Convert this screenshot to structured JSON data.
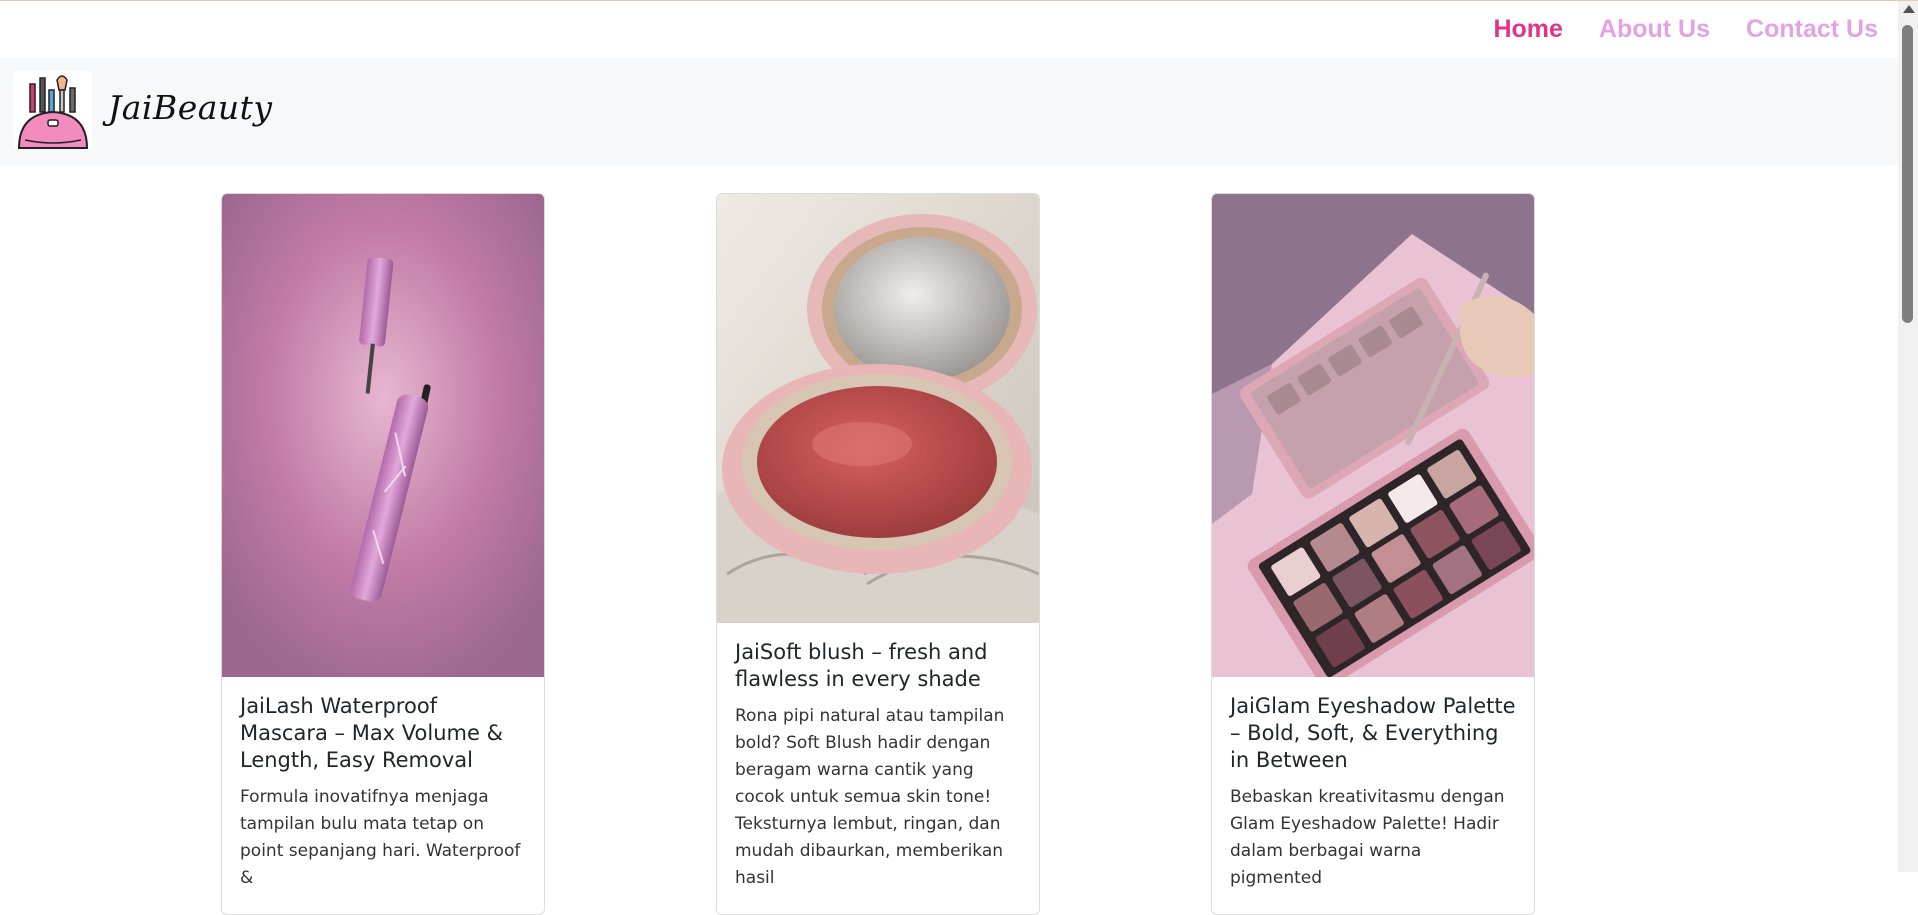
{
  "nav": {
    "items": [
      {
        "label": "Home",
        "active": true
      },
      {
        "label": "About Us",
        "active": false
      },
      {
        "label": "Contact Us",
        "active": false
      }
    ],
    "active_color": "#e0338a",
    "inactive_color": "#e3a2e6"
  },
  "brand": {
    "name": "JaiBeauty",
    "logo_icon": "makeup-bag-icon"
  },
  "products": [
    {
      "title": "JaiLash Waterproof Mascara – Max Volume & Length, Easy Removal",
      "description": "Formula inovatifnya menjaga tampilan bulu mata tetap on point sepanjang hari. Waterproof &",
      "image_icon": "mascara-image"
    },
    {
      "title": "JaiSoft blush – fresh and flawless in every shade",
      "description": "Rona pipi natural atau tampilan bold? Soft Blush hadir dengan beragam warna cantik yang cocok untuk semua skin tone! Teksturnya lembut, ringan, dan mudah dibaurkan, memberikan hasil",
      "image_icon": "blush-compact-image"
    },
    {
      "title": "JaiGlam Eyeshadow Palette – Bold, Soft, & Everything in Between",
      "description": "Bebaskan kreativitasmu dengan Glam Eyeshadow Palette! Hadir dalam berbagai warna pigmented",
      "image_icon": "eyeshadow-palette-image"
    }
  ]
}
